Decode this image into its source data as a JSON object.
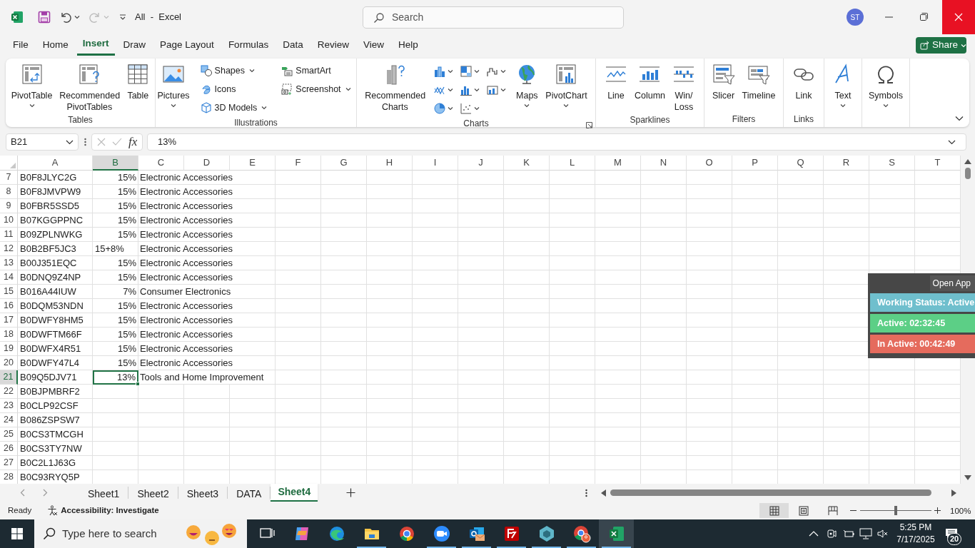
{
  "title_bar": {
    "title": "All  -  Excel",
    "search_placeholder": "Search",
    "avatar": "ST"
  },
  "menu_tabs": [
    {
      "label": "File",
      "selected": false
    },
    {
      "label": "Home",
      "selected": false
    },
    {
      "label": "Insert",
      "selected": true
    },
    {
      "label": "Draw",
      "selected": false
    },
    {
      "label": "Page Layout",
      "selected": false
    },
    {
      "label": "Formulas",
      "selected": false
    },
    {
      "label": "Data",
      "selected": false
    },
    {
      "label": "Review",
      "selected": false
    },
    {
      "label": "View",
      "selected": false
    },
    {
      "label": "Help",
      "selected": false
    }
  ],
  "share_button": "Share",
  "ribbon_groups": [
    {
      "label": "Tables",
      "items": [
        {
          "kind": "pivottable",
          "label": "PivotTable",
          "dropdown": true
        },
        {
          "kind": "recommendedpivot",
          "label": "Recommended PivotTables",
          "dropdown": false
        },
        {
          "kind": "table",
          "label": "Table",
          "dropdown": false
        }
      ]
    },
    {
      "label": "Illustrations",
      "items": [
        {
          "kind": "pictures",
          "label": "Pictures",
          "dropdown": true
        },
        {
          "kind": "shapes",
          "label": "Shapes",
          "dropdown": true
        },
        {
          "kind": "icons",
          "label": "Icons",
          "dropdown": false
        },
        {
          "kind": "models",
          "label": "3D Models",
          "dropdown": true
        },
        {
          "kind": "smartart",
          "label": "SmartArt",
          "dropdown": false
        },
        {
          "kind": "screenshot",
          "label": "Screenshot",
          "dropdown": true
        }
      ]
    },
    {
      "label": "Charts",
      "launcher": true,
      "items": [
        {
          "kind": "recommendedcharts",
          "label": "Recommended Charts",
          "dropdown": false
        },
        {
          "kind": "gallery"
        },
        {
          "kind": "maps",
          "label": "Maps",
          "dropdown": true
        },
        {
          "kind": "pivotchart",
          "label": "PivotChart",
          "dropdown": true
        }
      ]
    },
    {
      "label": "Sparklines",
      "items": [
        {
          "kind": "line",
          "label": "Line",
          "dropdown": false
        },
        {
          "kind": "column",
          "label": "Column",
          "dropdown": false
        },
        {
          "kind": "winloss",
          "label": "Win/Loss",
          "dropdown": false
        }
      ]
    },
    {
      "label": "Filters",
      "items": [
        {
          "kind": "slicer",
          "label": "Slicer",
          "dropdown": false
        },
        {
          "kind": "timeline",
          "label": "Timeline",
          "dropdown": false
        }
      ]
    },
    {
      "label": "Links",
      "items": [
        {
          "kind": "link",
          "label": "Link",
          "dropdown": false
        }
      ]
    },
    {
      "items": [
        {
          "kind": "text",
          "label": "Text",
          "dropdown": true
        }
      ]
    },
    {
      "items": [
        {
          "kind": "symbols",
          "label": "Symbols",
          "dropdown": true
        }
      ]
    }
  ],
  "formula_bar": {
    "name_box": "B21",
    "fx": "fx",
    "formula": "13%"
  },
  "columns": [
    {
      "label": "A",
      "selected": false
    },
    {
      "label": "B",
      "selected": true
    },
    {
      "label": "C",
      "selected": false
    },
    {
      "label": "D",
      "selected": false
    },
    {
      "label": "E",
      "selected": false
    },
    {
      "label": "F",
      "selected": false
    },
    {
      "label": "G",
      "selected": false
    },
    {
      "label": "H",
      "selected": false
    },
    {
      "label": "I",
      "selected": false
    },
    {
      "label": "J",
      "selected": false
    },
    {
      "label": "K",
      "selected": false
    },
    {
      "label": "L",
      "selected": false
    },
    {
      "label": "M",
      "selected": false
    },
    {
      "label": "N",
      "selected": false
    },
    {
      "label": "O",
      "selected": false
    },
    {
      "label": "P",
      "selected": false
    },
    {
      "label": "Q",
      "selected": false
    },
    {
      "label": "R",
      "selected": false
    },
    {
      "label": "S",
      "selected": false
    },
    {
      "label": "T",
      "selected": false
    }
  ],
  "rows": [
    {
      "number": "7",
      "a": "B0F8JLYC2G",
      "b": {
        "text": "15%",
        "kind": "number"
      },
      "c": "Electronic Accessories",
      "selected": false
    },
    {
      "number": "8",
      "a": "B0F8JMVPW9",
      "b": {
        "text": "15%",
        "kind": "number"
      },
      "c": "Electronic Accessories",
      "selected": false
    },
    {
      "number": "9",
      "a": "B0FBR5SSD5",
      "b": {
        "text": "15%",
        "kind": "number"
      },
      "c": "Electronic Accessories",
      "selected": false
    },
    {
      "number": "10",
      "a": "B07KGGPPNC",
      "b": {
        "text": "15%",
        "kind": "number"
      },
      "c": "Electronic Accessories",
      "selected": false
    },
    {
      "number": "11",
      "a": "B09ZPLNWKG",
      "b": {
        "text": "15%",
        "kind": "number"
      },
      "c": "Electronic Accessories",
      "selected": false
    },
    {
      "number": "12",
      "a": "B0B2BF5JC3",
      "b": {
        "text": "15+8%",
        "kind": "text"
      },
      "c": "Electronic Accessories",
      "selected": false
    },
    {
      "number": "13",
      "a": "B00J351EQC",
      "b": {
        "text": "15%",
        "kind": "number"
      },
      "c": "Electronic Accessories",
      "selected": false
    },
    {
      "number": "14",
      "a": "B0DNQ9Z4NP",
      "b": {
        "text": "15%",
        "kind": "number"
      },
      "c": "Electronic Accessories",
      "selected": false
    },
    {
      "number": "15",
      "a": "B016A44IUW",
      "b": {
        "text": "7%",
        "kind": "number"
      },
      "c": "Consumer Electronics",
      "selected": false
    },
    {
      "number": "16",
      "a": "B0DQM53NDN",
      "b": {
        "text": "15%",
        "kind": "number"
      },
      "c": "Electronic Accessories",
      "selected": false
    },
    {
      "number": "17",
      "a": "B0DWFY8HM5",
      "b": {
        "text": "15%",
        "kind": "number"
      },
      "c": "Electronic Accessories",
      "selected": false
    },
    {
      "number": "18",
      "a": "B0DWFTM66F",
      "b": {
        "text": "15%",
        "kind": "number"
      },
      "c": "Electronic Accessories",
      "selected": false
    },
    {
      "number": "19",
      "a": "B0DWFX4R51",
      "b": {
        "text": "15%",
        "kind": "number"
      },
      "c": "Electronic Accessories",
      "selected": false
    },
    {
      "number": "20",
      "a": "B0DWFY47L4",
      "b": {
        "text": "15%",
        "kind": "number"
      },
      "c": "Electronic Accessories",
      "selected": false
    },
    {
      "number": "21",
      "a": "B09Q5DJV71",
      "b": {
        "text": "13%",
        "kind": "number"
      },
      "c": "Tools and Home Improvement",
      "selected": true
    },
    {
      "number": "22",
      "a": "B0BJPMBRF2",
      "selected": false
    },
    {
      "number": "23",
      "a": "B0CLP92CSF",
      "selected": false
    },
    {
      "number": "24",
      "a": "B086ZSPSW7",
      "selected": false
    },
    {
      "number": "25",
      "a": "B0CS3TMCGH",
      "selected": false
    },
    {
      "number": "26",
      "a": "B0CS3TY7NW",
      "selected": false
    },
    {
      "number": "27",
      "a": "B0C2L1J63G",
      "selected": false
    },
    {
      "number": "28",
      "a": "B0C93RYQ5P",
      "selected": false
    }
  ],
  "sheet_tabs": [
    {
      "label": "Sheet1",
      "selected": false
    },
    {
      "label": "Sheet2",
      "selected": false
    },
    {
      "label": "Sheet3",
      "selected": false
    },
    {
      "label": "DATA",
      "selected": false
    },
    {
      "label": "Sheet4",
      "selected": true
    }
  ],
  "status_bar": {
    "status": "Ready",
    "accessibility": "Accessibility: Investigate",
    "views": [
      {
        "kind": "normal",
        "selected": true
      },
      {
        "kind": "pagelayout",
        "selected": false
      },
      {
        "kind": "pagebreak",
        "selected": false
      }
    ],
    "zoom": {
      "level": 0.5,
      "reading": "100%"
    }
  },
  "tracker_widget": {
    "open_label": "Open App",
    "statuses": [
      {
        "text": "Working Status: Active",
        "color": "#6fbfcd"
      },
      {
        "text": "Active: 02:32:45",
        "color": "#5ccf86"
      },
      {
        "text": "In Active: 00:42:49",
        "color": "#e56b5d"
      }
    ]
  },
  "taskbar": {
    "search_placeholder": "Type here to search",
    "apps": [
      {
        "kind": "taskview",
        "running": false,
        "selected": false
      },
      {
        "kind": "copilot",
        "running": false,
        "selected": false
      },
      {
        "kind": "edge",
        "running": false,
        "selected": false
      },
      {
        "kind": "explorer",
        "running": true,
        "selected": false
      },
      {
        "kind": "chrome",
        "running": false,
        "selected": false
      },
      {
        "kind": "zoom",
        "running": true,
        "selected": false
      },
      {
        "kind": "outlook",
        "running": true,
        "selected": false
      },
      {
        "kind": "filezilla",
        "running": true,
        "selected": false
      },
      {
        "kind": "cube",
        "running": true,
        "selected": false
      },
      {
        "kind": "chromeprofile",
        "running": true,
        "selected": false
      },
      {
        "kind": "excel",
        "running": true,
        "selected": true
      }
    ],
    "time": "5:25 PM",
    "date": "7/17/2025",
    "notifications": "20"
  }
}
